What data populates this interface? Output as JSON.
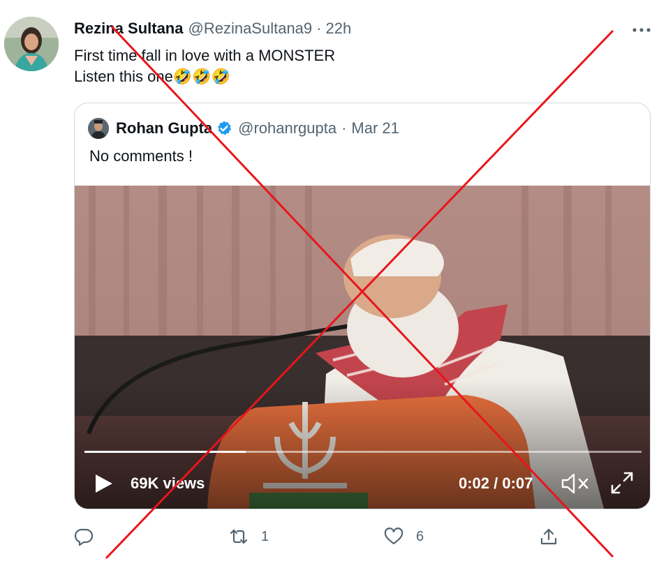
{
  "tweet": {
    "author": {
      "display_name": "Rezina Sultana",
      "handle": "@RezinaSultana9",
      "separator": "·",
      "time": "22h"
    },
    "text": "First time fall in love with a MONSTER\nListen this one🤣🤣🤣",
    "more_icon": "more-dots-icon"
  },
  "quoted_tweet": {
    "author": {
      "display_name": "Rohan Gupta",
      "verified_icon": "verified-badge-icon",
      "handle": "@rohanrgupta",
      "separator": "·",
      "date": "Mar 21"
    },
    "text": "No comments !",
    "video": {
      "views": "69K views",
      "timecode": "0:02 / 0:07",
      "progress": 0.29,
      "play_icon": "play-icon",
      "mute_icon": "mute-icon",
      "fullscreen_icon": "fullscreen-icon"
    }
  },
  "actions": {
    "reply": {
      "icon": "reply-icon",
      "count": ""
    },
    "retweet": {
      "icon": "retweet-icon",
      "count": "1"
    },
    "like": {
      "icon": "heart-icon",
      "count": "6"
    },
    "share": {
      "icon": "share-icon",
      "count": ""
    }
  },
  "overlay": {
    "cross_color": "#e8151b"
  },
  "colors": {
    "verified_blue": "#1d9bf0",
    "secondary_text": "#536471"
  }
}
